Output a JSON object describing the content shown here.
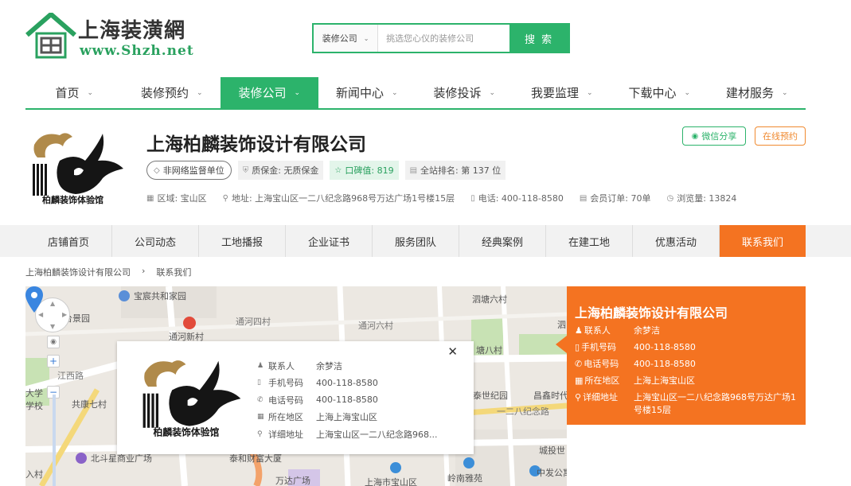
{
  "site": {
    "title": "上海装潢網",
    "url": "www.Shzh.net"
  },
  "search": {
    "category": "装修公司",
    "placeholder": "挑选您心仪的装修公司",
    "button": "搜 索"
  },
  "main_nav": {
    "items": [
      {
        "label": "首页"
      },
      {
        "label": "装修预约"
      },
      {
        "label": "装修公司",
        "active": true
      },
      {
        "label": "新闻中心"
      },
      {
        "label": "装修投诉"
      },
      {
        "label": "我要监理"
      },
      {
        "label": "下载中心"
      },
      {
        "label": "建材服务"
      }
    ]
  },
  "company": {
    "name": "上海柏麟装饰设计有限公司",
    "logo_text": "柏麟装饰体验馆",
    "share": "微信分享",
    "book": "在线预约",
    "badges": {
      "supervision": "非网络监督单位",
      "deposit": "质保金: 无质保金",
      "reputation": "口碑值: 819",
      "rank": "全站排名: 第 137 位"
    },
    "info": {
      "region": "区域: 宝山区",
      "address": "地址: 上海宝山区一二八纪念路968号万达广场1号楼15层",
      "phone": "电话: 400-118-8580",
      "orders": "会员订单: 70单",
      "views": "浏览量: 13824"
    }
  },
  "shop_nav": {
    "items": [
      {
        "label": "店铺首页"
      },
      {
        "label": "公司动态"
      },
      {
        "label": "工地播报"
      },
      {
        "label": "企业证书"
      },
      {
        "label": "服务团队"
      },
      {
        "label": "经典案例"
      },
      {
        "label": "在建工地"
      },
      {
        "label": "优惠活动"
      },
      {
        "label": "联系我们",
        "active": true
      }
    ]
  },
  "breadcrumb": {
    "home": "上海柏麟装饰设计有限公司",
    "sep": "›",
    "current": "联系我们"
  },
  "map": {
    "labels": {
      "l1": "宝宸共和家园",
      "l2": "通河新村",
      "l3": "通河四村",
      "l4": "通河六村",
      "l5": "泗塘六村",
      "l6": "台景园",
      "l7": "大学",
      "l8": "学校",
      "l9": "共康七村",
      "l10": "北斗星商业广场",
      "l11": "泰和财富大厦",
      "l12": "万达广场",
      "l13": "上海市宝山区",
      "l14": "岭南雅苑",
      "l15": "中发公寓",
      "l16": "泰世纪园",
      "l17": "昌鑫时代",
      "l18": "一二八纪念路",
      "l19": "城投世",
      "l20": "塘八村",
      "l21": "江西路",
      "l22": "泗",
      "l23": "入村"
    },
    "popup": {
      "rows": [
        {
          "key": "联系人",
          "value": "余梦洁"
        },
        {
          "key": "手机号码",
          "value": "400-118-8580"
        },
        {
          "key": "电话号码",
          "value": "400-118-8580"
        },
        {
          "key": "所在地区",
          "value": "上海上海宝山区"
        },
        {
          "key": "详细地址",
          "value": "上海宝山区一二八纪念路968..."
        }
      ]
    }
  },
  "contact_card": {
    "title": "上海柏麟装饰设计有限公司",
    "rows": [
      {
        "key": "联系人",
        "value": "余梦洁"
      },
      {
        "key": "手机号码",
        "value": "400-118-8580"
      },
      {
        "key": "电话号码",
        "value": "400-118-8580"
      },
      {
        "key": "所在地区",
        "value": "上海上海宝山区"
      },
      {
        "key": "详细地址",
        "value": "上海宝山区一二八纪念路968号万达广场1号楼15层"
      }
    ]
  },
  "colors": {
    "brand_green": "#2cb36b",
    "accent_orange": "#f47321"
  }
}
